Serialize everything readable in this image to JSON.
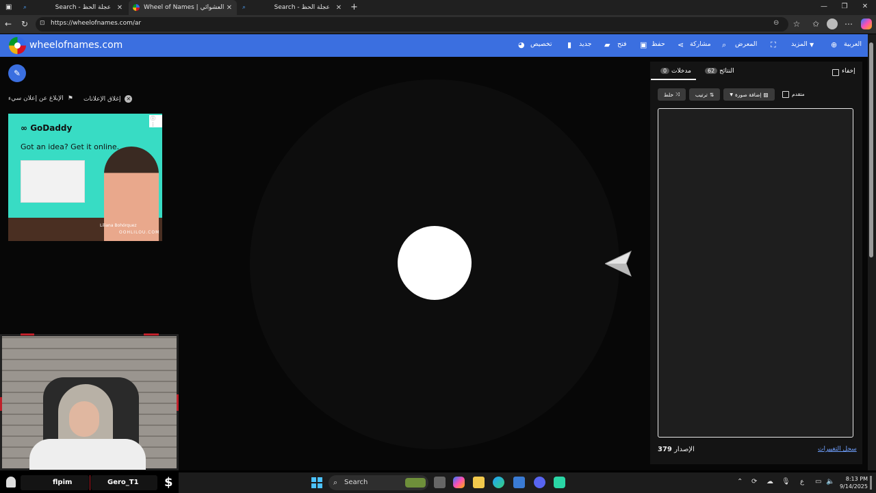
{
  "browser": {
    "tabs": [
      {
        "title": "Search - عجلة الحظ"
      },
      {
        "title": "Wheel of Names | الاسم العشوائي"
      },
      {
        "title": "Search - عجلة الحظ"
      }
    ],
    "url": "https://wheelofnames.com/ar"
  },
  "site": {
    "logo_text": "wheelofnames.com",
    "menu": {
      "language": "العربية",
      "more": "المزيد",
      "gallery": "المعرض",
      "share": "مشاركة",
      "save": "حفظ",
      "open": "فتح",
      "new": "جديد",
      "customize": "تخصيص"
    }
  },
  "ads": {
    "report": "الإبلاغ عن إعلان سيء",
    "close": "إغلاق الإعلانات",
    "creative": {
      "brand": "GoDaddy",
      "tagline": "Got an idea? Get it online.",
      "credit": "Liliana Bohórquez",
      "domain": "OOHLILOU.COM"
    }
  },
  "panel": {
    "hide_label": "إخفاء",
    "tab_results": {
      "label": "النتائج",
      "count": "62"
    },
    "tab_entries": {
      "label": "مدخلات",
      "count": "0"
    },
    "advanced_label": "متقدم",
    "add_image_label": "إضافة صورة",
    "sort_label": "ترتيب",
    "shuffle_label": "خلط",
    "version_label": "الإصدار",
    "version_number": "379",
    "changelog_label": "سجل التغييرات"
  },
  "overlay": {
    "name_left": "flpim",
    "name_right": "Gero_T1"
  },
  "taskbar": {
    "search": "Search",
    "time": "8:13 PM",
    "date": "9/14/2025",
    "lang": "ع"
  },
  "colors": {
    "header_blue": "#3b6fe0",
    "link_blue": "#6fa0ff"
  }
}
